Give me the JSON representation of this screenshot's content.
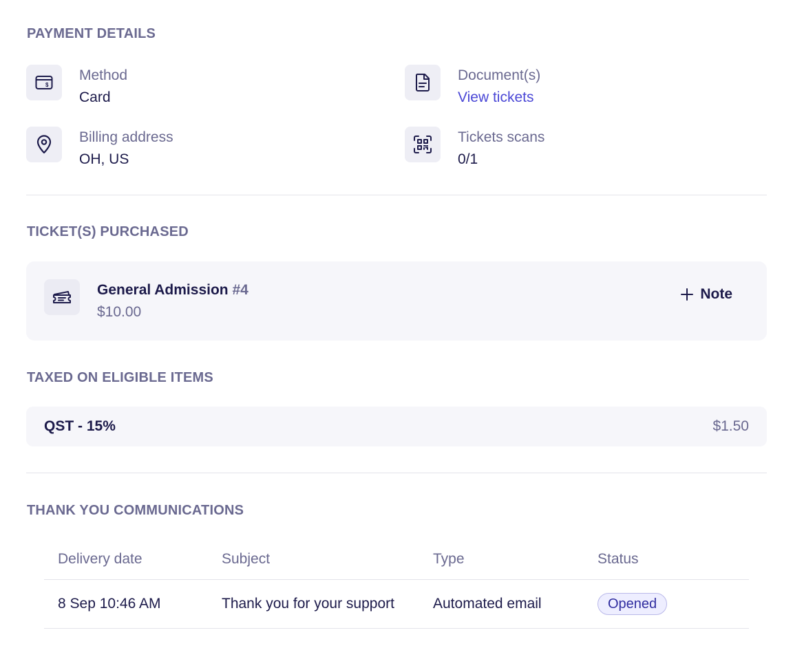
{
  "payment_details": {
    "title": "PAYMENT DETAILS",
    "method": {
      "label": "Method",
      "value": "Card",
      "icon": "card-icon"
    },
    "documents": {
      "label": "Document(s)",
      "value": "View tickets",
      "icon": "document-icon"
    },
    "billing": {
      "label": "Billing address",
      "value": "OH, US",
      "icon": "location-pin-icon"
    },
    "scans": {
      "label": "Tickets scans",
      "value": "0/1",
      "icon": "qr-scan-icon"
    }
  },
  "tickets": {
    "title": "TICKET(S) PURCHASED",
    "items": [
      {
        "name": "General Admission",
        "number": "#4",
        "price": "$10.00",
        "icon": "ticket-icon"
      }
    ],
    "note_label": "Note"
  },
  "taxes": {
    "title": "TAXED ON ELIGIBLE ITEMS",
    "items": [
      {
        "name": "QST - 15%",
        "amount": "$1.50"
      }
    ]
  },
  "communications": {
    "title": "THANK YOU COMMUNICATIONS",
    "columns": [
      "Delivery date",
      "Subject",
      "Type",
      "Status"
    ],
    "rows": [
      {
        "date": "8 Sep 10:46 AM",
        "subject": "Thank you for your support",
        "type": "Automated email",
        "status": "Opened"
      }
    ]
  },
  "colors": {
    "accent_link": "#4a47d6",
    "muted_text": "#6a6990",
    "primary_text": "#1c1a4a",
    "badge_bg": "#eeeeff"
  }
}
